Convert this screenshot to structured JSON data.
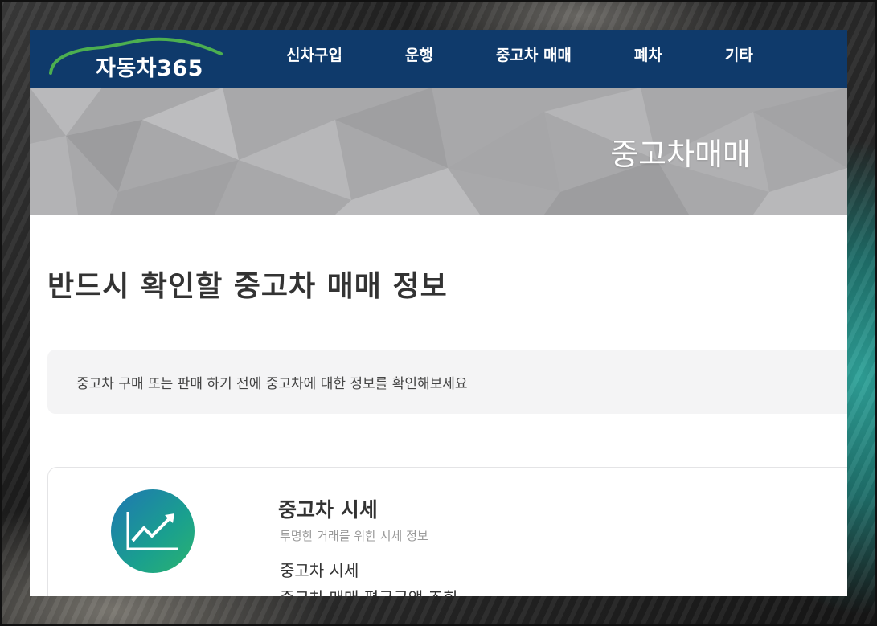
{
  "header": {
    "logo_text": "자동차365",
    "nav": [
      "신차구입",
      "운행",
      "중고차 매매",
      "폐차",
      "기타"
    ]
  },
  "hero": {
    "title": "중고차매매"
  },
  "main": {
    "heading": "반드시 확인할 중고차 매매 정보",
    "notice": "중고차 구매 또는 판매 하기 전에 중고차에 대한 정보를 확인해보세요",
    "card": {
      "icon": "chart-trend-up-icon",
      "title": "중고차 시세",
      "subtitle": "투명한 거래를 위한 시세 정보",
      "links": [
        "중고차 시세",
        "중고차 매매 평균금액 조회"
      ]
    }
  },
  "colors": {
    "header_bg": "#0f3a6b",
    "logo_arc": "#4caf50",
    "icon_gradient_start": "#1f76b3",
    "icon_gradient_end": "#2bb36f"
  }
}
